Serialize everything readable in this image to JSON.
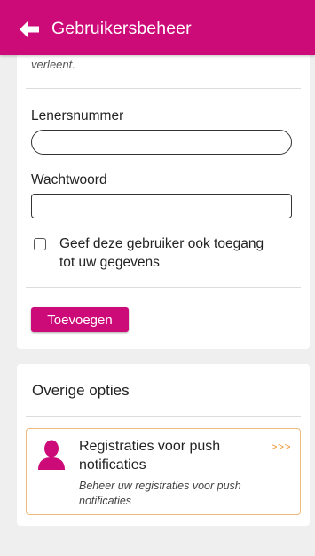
{
  "header": {
    "title": "Gebruikersbeheer"
  },
  "form_card": {
    "cut_text": "verleent.",
    "lener_label": "Lenersnummer",
    "lener_value": "",
    "password_label": "Wachtwoord",
    "password_value": "",
    "checkbox_label": "Geef deze gebruiker ook toegang tot uw gegevens",
    "checkbox_checked": false,
    "add_button_label": "Toevoegen"
  },
  "options_card": {
    "title": "Overige opties",
    "items": [
      {
        "title": "Registraties voor push notificaties",
        "subtitle": "Beheer uw registraties voor push notificaties",
        "arrow": ">>>",
        "icon": "user-icon"
      }
    ]
  },
  "colors": {
    "brand": "#cc0a78",
    "accent": "#f29a3a",
    "option_border": "#f0b97d",
    "background": "#efefef"
  }
}
